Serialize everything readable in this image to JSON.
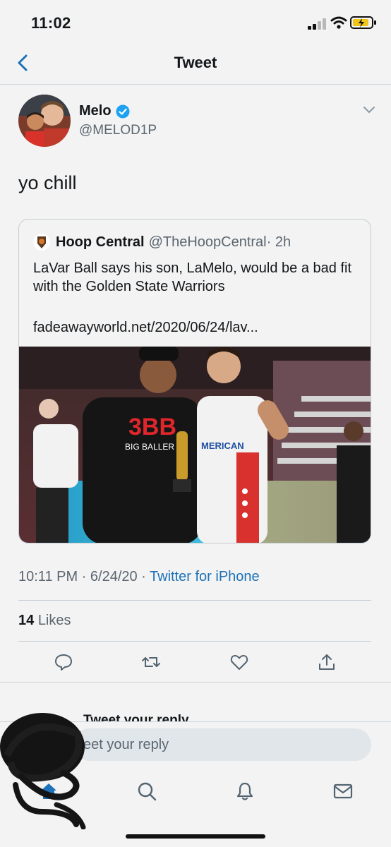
{
  "status_bar": {
    "time": "11:02"
  },
  "nav": {
    "title": "Tweet"
  },
  "author": {
    "name": "Melo",
    "handle": "@MELOD1P"
  },
  "tweet": {
    "text": "yo chill"
  },
  "quoted_tweet": {
    "name": "Hoop Central",
    "handle": "@TheHoopCentral",
    "age": "· 2h",
    "text": "LaVar Ball says his son, LaMelo, would be a bad fit with the Golden State Warriors",
    "link": "fadeawayworld.net/2020/06/24/lav...",
    "photo_shirt_text": "BIG BALLER",
    "photo_jersey_text": "MERICAN"
  },
  "meta": {
    "timestamp": "10:11 PM · 6/24/20 · ",
    "source": "Twitter for iPhone"
  },
  "stats": {
    "likes_count": "14",
    "likes_label": "Likes"
  },
  "reply": {
    "peek_text": "Tweet your reply",
    "placeholder": "eet your reply"
  },
  "colors": {
    "accent": "#1d72b8",
    "verified": "#1da1f2",
    "background": "#f3f3f3"
  },
  "icons": [
    "chevron-left-icon",
    "verified-icon",
    "chevron-down-icon",
    "reply-icon",
    "retweet-icon",
    "like-icon",
    "share-icon",
    "home-icon",
    "search-icon",
    "notifications-icon",
    "messages-icon"
  ]
}
